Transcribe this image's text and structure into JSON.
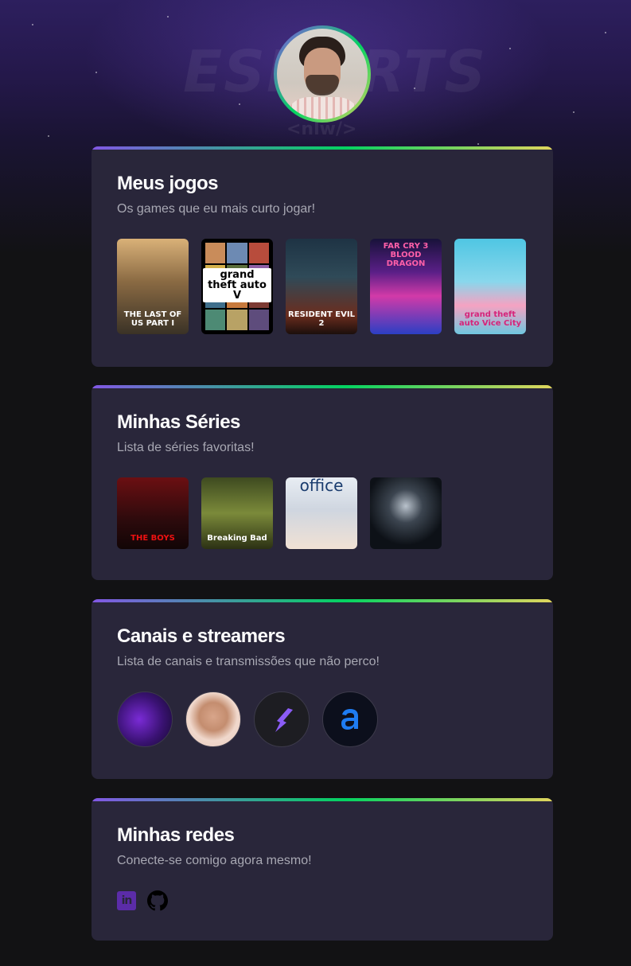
{
  "header": {
    "avatar_icon": "profile-photo",
    "watermark_main": "ESPORTS",
    "watermark_sub": "<nlw/>"
  },
  "sections": {
    "games": {
      "title": "Meus jogos",
      "subtitle": "Os games que eu mais curto jogar!",
      "items": [
        {
          "caption": "THE LAST OF US PART I",
          "icon": "the-last-of-us-cover"
        },
        {
          "caption": "grand theft auto V",
          "icon": "gta-v-cover"
        },
        {
          "caption": "RESIDENT EVIL 2",
          "icon": "resident-evil-2-cover"
        },
        {
          "caption": "FAR CRY 3 BLOOD DRAGON",
          "icon": "far-cry-3-blood-dragon-cover"
        },
        {
          "caption": "grand theft auto Vice City",
          "icon": "gta-vice-city-cover"
        }
      ]
    },
    "series": {
      "title": "Minhas Séries",
      "subtitle": "Lista de séries favoritas!",
      "items": [
        {
          "caption": "THE BOYS",
          "icon": "the-boys-poster"
        },
        {
          "caption": "Breaking Bad",
          "icon": "breaking-bad-poster"
        },
        {
          "caption": "office",
          "icon": "the-office-poster"
        },
        {
          "caption": "",
          "icon": "black-mirror-poster"
        }
      ]
    },
    "streamers": {
      "title": "Canais e streamers",
      "subtitle": "Lista de canais e transmissões que não perco!",
      "items": [
        {
          "icon": "streamer-avatar-1"
        },
        {
          "icon": "streamer-avatar-2"
        },
        {
          "icon": "rocketseat-logo"
        },
        {
          "icon": "alura-logo"
        }
      ]
    },
    "social": {
      "title": "Minhas redes",
      "subtitle": "Conecte-se comigo agora mesmo!",
      "linkedin_label": "in",
      "links": [
        {
          "icon": "linkedin-icon"
        },
        {
          "icon": "github-icon"
        }
      ]
    }
  },
  "colors": {
    "background": "#121214",
    "card": "#29263a",
    "accent_gradient": [
      "#8257e5",
      "#04d361",
      "#e1d55d"
    ],
    "title": "#ffffff",
    "subtitle": "#a8a8b3"
  }
}
